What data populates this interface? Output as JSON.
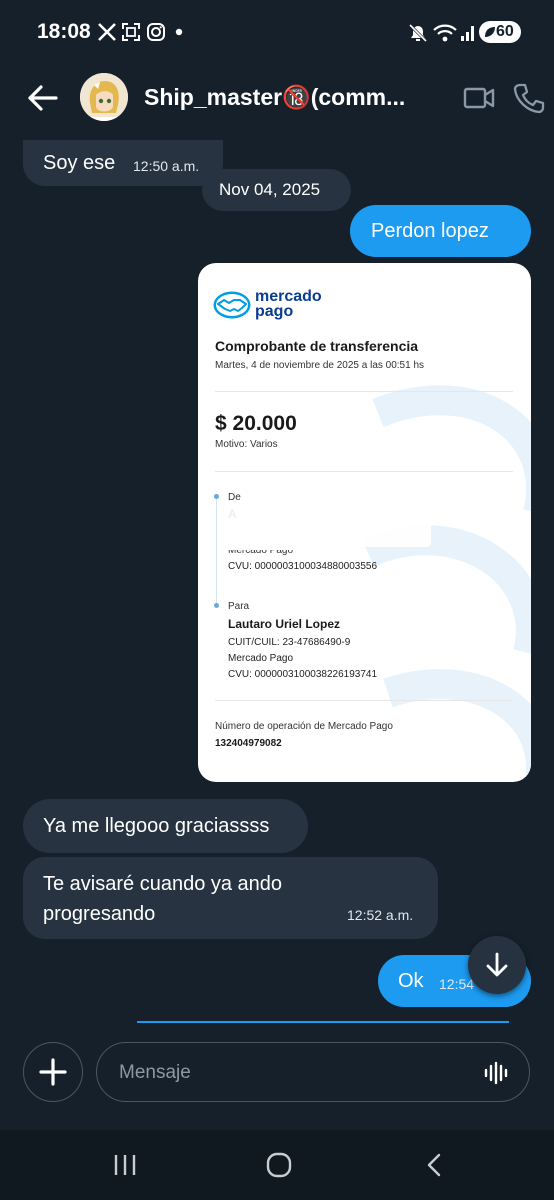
{
  "status_bar": {
    "time": "18:08",
    "battery": "60"
  },
  "header": {
    "contact_name": "Ship_master🔞(comm..."
  },
  "messages": [
    {
      "text": "Soy ese",
      "time": "12:50 a.m."
    },
    {
      "date_divider": "Nov 04, 2025"
    },
    {
      "text": "Perdon lopez"
    },
    {
      "text": "Ya me llegooo graciassss"
    },
    {
      "text_line1": "Te avisaré cuando ya ando",
      "text_line2": "progresando",
      "time": "12:52 a.m."
    },
    {
      "text": "Ok",
      "time": "12:54"
    }
  ],
  "receipt": {
    "brand_line1": "mercado",
    "brand_line2": "pago",
    "title": "Comprobante de transferencia",
    "datetime": "Martes, 4 de noviembre de 2025 a las 00:51 hs",
    "amount": "$ 20.000",
    "motivo": "Motivo: Varios",
    "from_label": "De",
    "from_name": "A",
    "from_bank": "Mercado Pago",
    "from_cvu": "CVU: 0000003100034880003556",
    "to_label": "Para",
    "to_name": "Lautaro Uriel Lopez",
    "to_cuit": "CUIT/CUIL: 23-47686490-9",
    "to_bank": "Mercado Pago",
    "to_cvu": "CVU: 0000003100038226193741",
    "operation_label": "Número de operación de Mercado Pago",
    "operation_number": "132404979082"
  },
  "composer": {
    "placeholder": "Mensaje"
  },
  "colors": {
    "background": "#15202b",
    "incoming_bubble": "#273340",
    "outgoing_bubble": "#1d9bf0",
    "brand_blue": "#009ee3"
  },
  "icons": [
    "x-logo-icon",
    "screenshot-icon",
    "instagram-icon",
    "mute-icon",
    "wifi-icon",
    "signal-icon",
    "back-arrow-icon",
    "video-call-icon",
    "phone-icon",
    "scroll-down-icon",
    "plus-icon",
    "voice-wave-icon",
    "recent-apps-icon",
    "home-icon",
    "nav-back-icon"
  ]
}
